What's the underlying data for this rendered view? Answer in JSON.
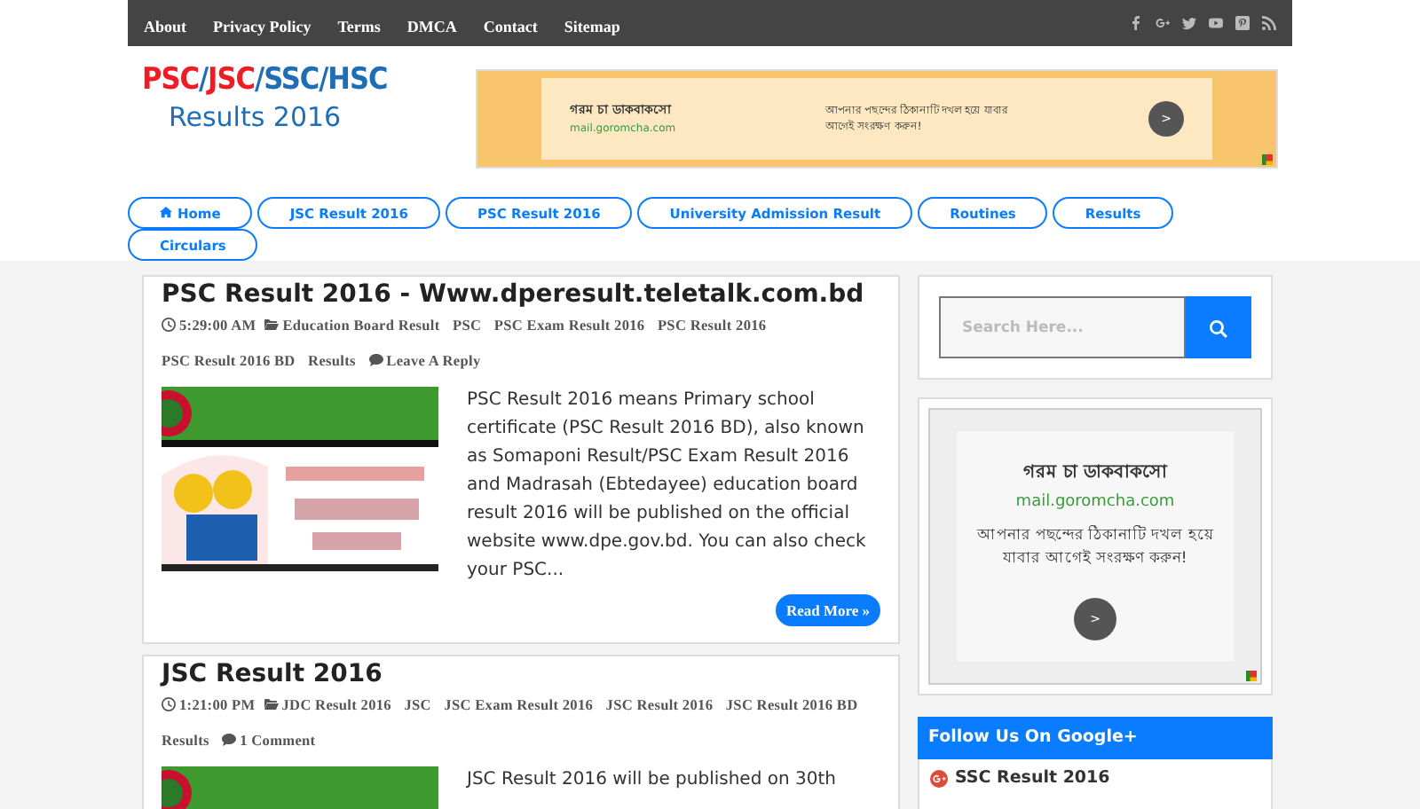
{
  "top_menu": [
    "About",
    "Privacy Policy",
    "Terms",
    "DMCA",
    "Contact",
    "Sitemap"
  ],
  "logo": {
    "parts": [
      {
        "text": "PSC",
        "color": "#ee1c25"
      },
      {
        "text": "/",
        "color": "#1f6db5"
      },
      {
        "text": "JSC",
        "color": "#ee1c25"
      },
      {
        "text": "/",
        "color": "#1f6db5"
      },
      {
        "text": "SSC",
        "color": "#1f6db5"
      },
      {
        "text": "/",
        "color": "#1f6db5"
      },
      {
        "text": "HSC",
        "color": "#1f6db5"
      }
    ],
    "subtitle": "Results 2016"
  },
  "banner_ad": {
    "title": "গরম চা ডাকবাকসো",
    "url": "mail.goromcha.com",
    "message": "আপনার পছন্দের ঠিকানাটি দখল হয়ে যাবার আগেই সংরক্ষণ করুন!",
    "button": ">"
  },
  "nav": [
    {
      "label": "Home",
      "kind": "home"
    },
    {
      "label": "JSC Result 2016",
      "kind": "plain"
    },
    {
      "label": "PSC Result 2016",
      "kind": "plain"
    },
    {
      "label": "University Admission Result",
      "kind": "plain"
    },
    {
      "label": "Routines",
      "kind": "plain"
    },
    {
      "label": "Results",
      "kind": "plain"
    },
    {
      "label": "Circulars",
      "kind": "plain"
    }
  ],
  "posts": [
    {
      "title": "PSC Result 2016 - Www.dperesult.teletalk.com.bd",
      "time": "5:29:00 AM",
      "tags": [
        "Education Board Result",
        "PSC",
        "PSC Exam Result 2016",
        "PSC Result 2016",
        "PSC Result 2016 BD",
        "Results"
      ],
      "comments": "Leave A Reply",
      "excerpt": "PSC Result 2016 means Primary school certificate (PSC Result 2016 BD), also known as Somaponi Result/PSC Exam Result 2016 and Madrasah (Ebtedayee) education board result 2016 will be published on the official website www.dpe.gov.bd. You can also check your PSC...",
      "read_more": "Read More »"
    },
    {
      "title": "JSC Result 2016",
      "time": "1:21:00 PM",
      "tags": [
        "JDC Result 2016",
        "JSC",
        "JSC Exam Result 2016",
        "JSC Result 2016",
        "JSC Result 2016 BD",
        "Results"
      ],
      "comments": "1 Comment",
      "excerpt": "JSC Result 2016 will be published on 30th"
    }
  ],
  "sidebar": {
    "search": {
      "placeholder": "Search Here..."
    },
    "ad": {
      "title": "গরম চা ডাকবাকসো",
      "url": "mail.goromcha.com",
      "message": "আপনার পছন্দের ঠিকানাটি দখল হয়ে যাবার আগেই সংরক্ষণ করুন!",
      "button": ">"
    },
    "follow": {
      "title": "Follow Us On Google+",
      "item": "SSC Result 2016"
    }
  }
}
